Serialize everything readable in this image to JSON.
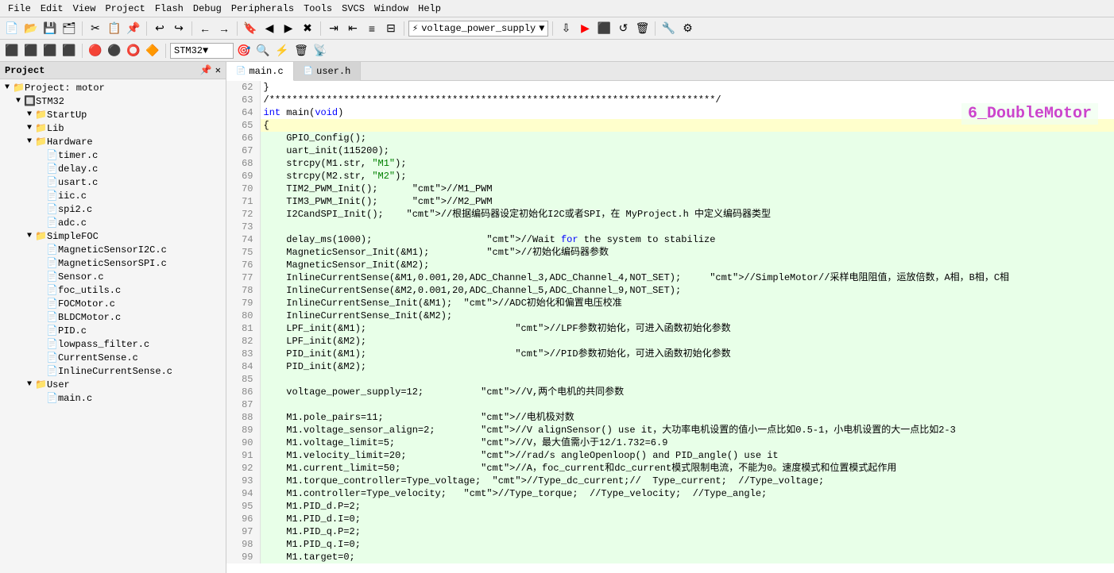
{
  "menubar": {
    "items": [
      "File",
      "Edit",
      "View",
      "Project",
      "Flash",
      "Debug",
      "Peripherals",
      "Tools",
      "SVCS",
      "Window",
      "Help"
    ]
  },
  "toolbar1": {
    "dropdown_value": "voltage_power_supply",
    "target_value": "STM32"
  },
  "tabs": [
    {
      "label": "main.c",
      "active": true
    },
    {
      "label": "user.h",
      "active": false
    }
  ],
  "sidebar": {
    "title": "Project",
    "tree": [
      {
        "level": 0,
        "expanded": true,
        "type": "project",
        "label": "Project: motor"
      },
      {
        "level": 1,
        "expanded": true,
        "type": "chip",
        "label": "STM32"
      },
      {
        "level": 2,
        "expanded": true,
        "type": "folder",
        "label": "StartUp"
      },
      {
        "level": 2,
        "expanded": true,
        "type": "folder",
        "label": "Lib"
      },
      {
        "level": 2,
        "expanded": true,
        "type": "folder",
        "label": "Hardware"
      },
      {
        "level": 3,
        "type": "file",
        "label": "timer.c"
      },
      {
        "level": 3,
        "type": "file",
        "label": "delay.c"
      },
      {
        "level": 3,
        "type": "file",
        "label": "usart.c"
      },
      {
        "level": 3,
        "type": "file",
        "label": "iic.c"
      },
      {
        "level": 3,
        "type": "file",
        "label": "spi2.c"
      },
      {
        "level": 3,
        "type": "file",
        "label": "adc.c"
      },
      {
        "level": 2,
        "expanded": true,
        "type": "folder",
        "label": "SimpleFOC"
      },
      {
        "level": 3,
        "type": "file",
        "label": "MagneticSensorI2C.c"
      },
      {
        "level": 3,
        "type": "file",
        "label": "MagneticSensorSPI.c"
      },
      {
        "level": 3,
        "type": "file",
        "label": "Sensor.c"
      },
      {
        "level": 3,
        "type": "file",
        "label": "foc_utils.c"
      },
      {
        "level": 3,
        "type": "file",
        "label": "FOCMotor.c"
      },
      {
        "level": 3,
        "type": "file",
        "label": "BLDCMotor.c"
      },
      {
        "level": 3,
        "type": "file",
        "label": "PID.c"
      },
      {
        "level": 3,
        "type": "file",
        "label": "lowpass_filter.c"
      },
      {
        "level": 3,
        "type": "file",
        "label": "CurrentSense.c"
      },
      {
        "level": 3,
        "type": "file",
        "label": "InlineCurrentSense.c"
      },
      {
        "level": 2,
        "expanded": true,
        "type": "folder",
        "label": "User"
      },
      {
        "level": 3,
        "type": "file",
        "label": "main.c"
      }
    ]
  },
  "annotation": "6_DoubleMotor",
  "code_lines": [
    {
      "num": 62,
      "content": "}"
    },
    {
      "num": 63,
      "content": "/******************************************************************************/",
      "highlight": false
    },
    {
      "num": 64,
      "content": "int main(void)",
      "highlight": false
    },
    {
      "num": 65,
      "content": "{",
      "highlight": true,
      "is_current": true
    },
    {
      "num": 66,
      "content": "    GPIO_Config();",
      "highlight": true
    },
    {
      "num": 67,
      "content": "    uart_init(115200);",
      "highlight": true
    },
    {
      "num": 68,
      "content": "    strcpy(M1.str, \"M1\");",
      "highlight": true
    },
    {
      "num": 69,
      "content": "    strcpy(M2.str, \"M2\");",
      "highlight": true
    },
    {
      "num": 70,
      "content": "    TIM2_PWM_Init();      //M1_PWM",
      "highlight": true
    },
    {
      "num": 71,
      "content": "    TIM3_PWM_Init();      //M2_PWM",
      "highlight": true
    },
    {
      "num": 72,
      "content": "    I2CandSPI_Init();    //根据编码器设定初始化I2C或者SPI，在 MyProject.h 中定义编码器类型",
      "highlight": true
    },
    {
      "num": 73,
      "content": "",
      "highlight": true
    },
    {
      "num": 74,
      "content": "    delay_ms(1000);                    //Wait for the system to stabilize",
      "highlight": true
    },
    {
      "num": 75,
      "content": "    MagneticSensor_Init(&M1);          //初始化编码器参数",
      "highlight": true
    },
    {
      "num": 76,
      "content": "    MagneticSensor_Init(&M2);",
      "highlight": true
    },
    {
      "num": 77,
      "content": "    InlineCurrentSense(&M1,0.001,20,ADC_Channel_3,ADC_Channel_4,NOT_SET);     //SimpleMotor//采样电阻阻值，运放倍数，A相，B相，C相",
      "highlight": true
    },
    {
      "num": 78,
      "content": "    InlineCurrentSense(&M2,0.001,20,ADC_Channel_5,ADC_Channel_9,NOT_SET);",
      "highlight": true
    },
    {
      "num": 79,
      "content": "    InlineCurrentSense_Init(&M1);  //ADC初始化和偏置电压校准",
      "highlight": true
    },
    {
      "num": 80,
      "content": "    InlineCurrentSense_Init(&M2);",
      "highlight": true
    },
    {
      "num": 81,
      "content": "    LPF_init(&M1);                          //LPF参数初始化，可进入函数初始化参数",
      "highlight": true
    },
    {
      "num": 82,
      "content": "    LPF_init(&M2);",
      "highlight": true
    },
    {
      "num": 83,
      "content": "    PID_init(&M1);                          //PID参数初始化，可进入函数初始化参数",
      "highlight": true
    },
    {
      "num": 84,
      "content": "    PID_init(&M2);",
      "highlight": true
    },
    {
      "num": 85,
      "content": "",
      "highlight": true
    },
    {
      "num": 86,
      "content": "    voltage_power_supply=12;          //V,两个电机的共同参数",
      "highlight": true
    },
    {
      "num": 87,
      "content": "",
      "highlight": true
    },
    {
      "num": 88,
      "content": "    M1.pole_pairs=11;                 //电机极对数",
      "highlight": true
    },
    {
      "num": 89,
      "content": "    M1.voltage_sensor_align=2;        //V alignSensor() use it，大功率电机设置的值小一点比如0.5-1，小电机设置的大一点比如2-3",
      "highlight": true
    },
    {
      "num": 90,
      "content": "    M1.voltage_limit=5;               //V，最大值需小于12/1.732=6.9",
      "highlight": true
    },
    {
      "num": 91,
      "content": "    M1.velocity_limit=20;             //rad/s angleOpenloop() and PID_angle() use it",
      "highlight": true
    },
    {
      "num": 92,
      "content": "    M1.current_limit=50;              //A，foc_current和dc_current模式限制电流，不能为0。速度模式和位置模式起作用",
      "highlight": true
    },
    {
      "num": 93,
      "content": "    M1.torque_controller=Type_voltage;  //Type_dc_current;//  Type_current;  //Type_voltage;",
      "highlight": true
    },
    {
      "num": 94,
      "content": "    M1.controller=Type_velocity;   //Type_torque;  //Type_velocity;  //Type_angle;",
      "highlight": true
    },
    {
      "num": 95,
      "content": "    M1.PID_d.P=2;",
      "highlight": true
    },
    {
      "num": 96,
      "content": "    M1.PID_d.I=0;",
      "highlight": true
    },
    {
      "num": 97,
      "content": "    M1.PID_q.P=2;",
      "highlight": true
    },
    {
      "num": 98,
      "content": "    M1.PID_q.I=0;",
      "highlight": true
    },
    {
      "num": 99,
      "content": "    M1.target=0;",
      "highlight": true
    }
  ]
}
